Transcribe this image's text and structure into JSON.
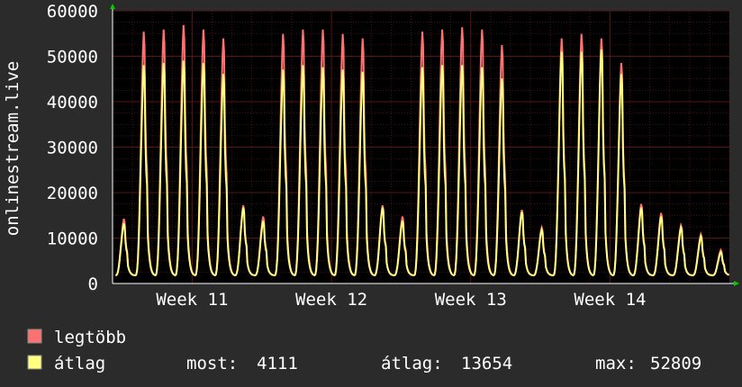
{
  "chart_data": {
    "type": "line",
    "ylabel": "onlinestream.live",
    "ylim": [
      0,
      60000
    ],
    "yticks": [
      0,
      10000,
      20000,
      30000,
      40000,
      50000,
      60000
    ],
    "xlim": [
      0,
      31
    ],
    "xticks": [
      {
        "label": "Week 11",
        "x": 4
      },
      {
        "label": "Week 12",
        "x": 11
      },
      {
        "label": "Week 13",
        "x": 18
      },
      {
        "label": "Week 14",
        "x": 25
      }
    ],
    "grid": true,
    "series": [
      {
        "name": "legtöbb",
        "color": "#ff7070",
        "daily": [
          [
            0.7,
            14500
          ],
          [
            1.7,
            56500
          ],
          [
            2.7,
            57000
          ],
          [
            3.7,
            58000
          ],
          [
            4.7,
            57000
          ],
          [
            5.7,
            55000
          ],
          [
            6.7,
            17500
          ],
          [
            7.7,
            15000
          ],
          [
            8.7,
            56000
          ],
          [
            9.7,
            57000
          ],
          [
            10.7,
            57000
          ],
          [
            11.7,
            56000
          ],
          [
            12.7,
            55000
          ],
          [
            13.7,
            17500
          ],
          [
            14.7,
            15000
          ],
          [
            15.7,
            56500
          ],
          [
            16.7,
            57000
          ],
          [
            17.7,
            57500
          ],
          [
            18.7,
            57000
          ],
          [
            19.7,
            53500
          ],
          [
            20.7,
            16500
          ],
          [
            21.7,
            12500
          ],
          [
            22.7,
            55000
          ],
          [
            23.7,
            56000
          ],
          [
            24.7,
            55000
          ],
          [
            25.7,
            49500
          ],
          [
            26.7,
            17800
          ],
          [
            27.7,
            15800
          ],
          [
            28.7,
            13000
          ],
          [
            29.7,
            11000
          ],
          [
            30.7,
            7500
          ]
        ]
      },
      {
        "name": "átlag",
        "color": "#ffff80",
        "daily": [
          [
            0.7,
            13500
          ],
          [
            1.7,
            49000
          ],
          [
            2.7,
            49500
          ],
          [
            3.7,
            50000
          ],
          [
            4.7,
            49500
          ],
          [
            5.7,
            47000
          ],
          [
            6.7,
            17000
          ],
          [
            7.7,
            14000
          ],
          [
            8.7,
            48000
          ],
          [
            9.7,
            49000
          ],
          [
            10.7,
            48500
          ],
          [
            11.7,
            48000
          ],
          [
            12.7,
            47500
          ],
          [
            13.7,
            17000
          ],
          [
            14.7,
            14000
          ],
          [
            15.7,
            48500
          ],
          [
            16.7,
            49000
          ],
          [
            17.7,
            49000
          ],
          [
            18.7,
            48500
          ],
          [
            19.7,
            46000
          ],
          [
            20.7,
            16000
          ],
          [
            21.7,
            12000
          ],
          [
            22.7,
            52000
          ],
          [
            23.7,
            52000
          ],
          [
            24.7,
            52500
          ],
          [
            25.7,
            47000
          ],
          [
            26.7,
            17000
          ],
          [
            27.7,
            15000
          ],
          [
            28.7,
            12500
          ],
          [
            29.7,
            10500
          ],
          [
            30.7,
            7000
          ]
        ]
      }
    ]
  },
  "legend": {
    "items": [
      {
        "label": "legtöbb",
        "color": "#ff7070"
      },
      {
        "label": "átlag",
        "color": "#ffff80"
      }
    ],
    "stats": {
      "most_label": "most:",
      "most_value": "4111",
      "avg_label": "átlag:",
      "avg_value": "13654",
      "max_label": "max:",
      "max_value": "52809"
    }
  },
  "colors": {
    "background": "#2b2b2b",
    "plot_background": "#000000",
    "grid": "#5a1515",
    "axis": "#ffffff",
    "arrow": "#00cc00"
  }
}
